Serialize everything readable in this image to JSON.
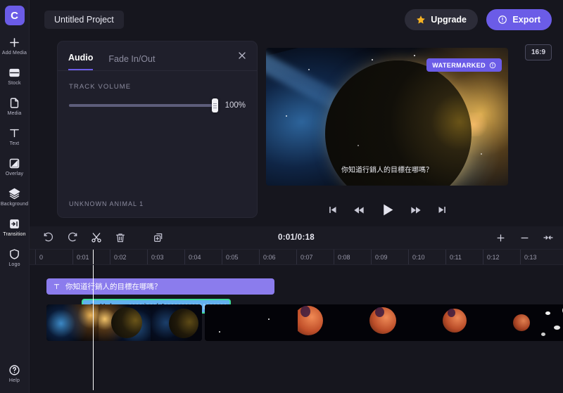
{
  "app": {
    "logo_letter": "C"
  },
  "sidebar": {
    "items": [
      {
        "label": "Add Media",
        "icon": "plus-icon"
      },
      {
        "label": "Stock",
        "icon": "stock-icon"
      },
      {
        "label": "Media",
        "icon": "media-file-icon"
      },
      {
        "label": "Text",
        "icon": "text-icon"
      },
      {
        "label": "Overlay",
        "icon": "overlay-icon"
      },
      {
        "label": "Background",
        "icon": "layers-icon"
      },
      {
        "label": "Transition",
        "icon": "transition-icon"
      },
      {
        "label": "Logo",
        "icon": "shield-icon"
      }
    ],
    "help": {
      "label": "Help",
      "icon": "help-circle-icon"
    }
  },
  "topbar": {
    "project_name": "Untitled Project",
    "upgrade_label": "Upgrade",
    "export_label": "Export"
  },
  "audio_panel": {
    "tabs": [
      {
        "label": "Audio",
        "active": true
      },
      {
        "label": "Fade In/Out",
        "active": false
      }
    ],
    "volume_label": "TRACK VOLUME",
    "volume_value": "100%",
    "volume_percent": 100,
    "track_name": "UNKNOWN ANIMAL 1"
  },
  "preview": {
    "watermark_label": "WATERMARKED",
    "caption": "你知道行銷人的目標在哪嗎？",
    "aspect_ratio": "16:9",
    "transport": [
      {
        "name": "skip-to-start-button"
      },
      {
        "name": "rewind-button"
      },
      {
        "name": "play-button"
      },
      {
        "name": "fast-forward-button"
      },
      {
        "name": "skip-to-end-button"
      }
    ]
  },
  "timeline": {
    "toolbar": [
      {
        "name": "undo-button"
      },
      {
        "name": "redo-button"
      },
      {
        "name": "split-button"
      },
      {
        "name": "delete-button"
      },
      {
        "name": "duplicate-button"
      }
    ],
    "time_display": "0:01/0:18",
    "zoom_in_label": "+",
    "zoom_out_label": "−",
    "fit_label": "→←",
    "ruler_ticks": [
      "0",
      "0:01",
      "0:02",
      "0:03",
      "0:04",
      "0:05",
      "0:06",
      "0:07",
      "0:08",
      "0:09",
      "0:10",
      "0:11",
      "0:12",
      "0:13"
    ],
    "playhead_position": "0:01",
    "clips": {
      "text": {
        "label": "你知道行銷人的目標在哪嗎？",
        "icon": "text-clip-icon"
      },
      "audio": {
        "label": "Unknown animal 1",
        "icon": "music-note-icon",
        "selected": true
      }
    }
  },
  "colors": {
    "accent": "#6b5ce7",
    "text_clip": "#8b7ced",
    "audio_clip": "#63b1ef",
    "selection": "#3ddc9a",
    "upgrade_star": "#f5b223"
  }
}
